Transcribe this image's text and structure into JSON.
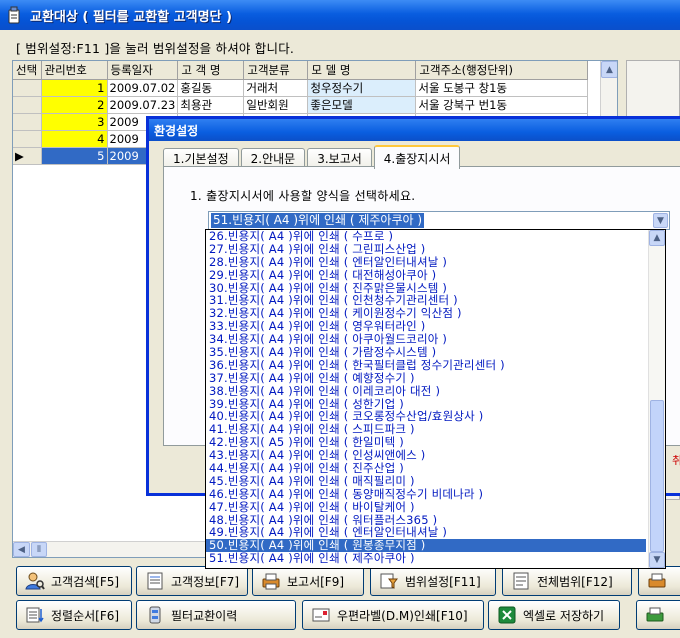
{
  "window": {
    "title": "교환대상 ( 필터를 교환할 고객명단 )"
  },
  "hint": "[ 범위설정:F11 ]을 눌러 범위설정을 하셔야 합니다.",
  "grid": {
    "headers": [
      "선택",
      "관리번호",
      "등록일자",
      "고 객 명",
      "고객분류",
      "모 델 명",
      "고객주소(행정단위)"
    ],
    "rows": [
      {
        "no": "1",
        "date": "2009.07.02",
        "name": "홍길동",
        "type": "거래처",
        "model": "청우정수기",
        "addr": "서울 도봉구 창1동"
      },
      {
        "no": "2",
        "date": "2009.07.23",
        "name": "최용관",
        "type": "일반회원",
        "model": "좋은모델",
        "addr": "서울 강북구 번1동"
      },
      {
        "no": "3",
        "date": "2009",
        "name": "",
        "type": "",
        "model": "",
        "addr": ""
      },
      {
        "no": "4",
        "date": "2009",
        "name": "",
        "type": "",
        "model": "",
        "addr": ""
      },
      {
        "no": "5",
        "date": "2009",
        "name": "",
        "type": "",
        "model": "",
        "addr": ""
      }
    ]
  },
  "dialog": {
    "title": "환경설정",
    "tabs": [
      "1.기본설정",
      "2.안내문",
      "3.보고서",
      "4.출장지시서"
    ],
    "prompt": "1. 출장지시서에 사용할 양식을 선택하세요.",
    "selected": "51.빈용지( A4 )위에 인쇄 ( 제주아쿠아 )",
    "side_text": "취"
  },
  "dropdown": {
    "items": [
      "26.빈용지( A4 )위에 인쇄 ( 수프로 )",
      "27.빈용지( A4 )위에 인쇄 ( 그린피스산업 )",
      "28.빈용지( A4 )위에 인쇄 ( 엔터알인터내셔날 )",
      "29.빈용지( A4 )위에 인쇄 ( 대전해성아쿠아 )",
      "30.빈용지( A4 )위에 인쇄 ( 진주맑은물시스템 )",
      "31.빈용지( A4 )위에 인쇄 ( 인천청수기관리센터 )",
      "32.빈용지( A4 )위에 인쇄 ( 케이원정수기 익산점 )",
      "33.빈용지( A4 )위에 인쇄 ( 영우워터라인 )",
      "34.빈용지( A4 )위에 인쇄 ( 아쿠아월드코리아 )",
      "35.빈용지( A4 )위에 인쇄 ( 가람정수시스템 )",
      "36.빈용지( A4 )위에 인쇄 ( 한국필터클럽 정수기관리센터 )",
      "37.빈용지( A4 )위에 인쇄 ( 예향정수기 )",
      "38.빈용지( A4 )위에 인쇄 ( 이레코리아 대전 )",
      "39.빈용지( A4 )위에 인쇄 ( 성한기업 )",
      "40.빈용지( A4 )위에 인쇄 ( 코오롱정수산업/효원상사 )",
      "41.빈용지( A4 )위에 인쇄 ( 스피드파크 )",
      "42.빈용지( A5 )위에 인쇄 ( 한일미텍 )",
      "43.빈용지( A4 )위에 인쇄 ( 인성씨앤에스 )",
      "44.빈용지( A4 )위에 인쇄 ( 진주산업 )",
      "45.빈용지( A4 )위에 인쇄 ( 매직필리미 )",
      "46.빈용지( A4 )위에 인쇄 ( 동양매직정수기 비데나라 )",
      "47.빈용지( A4 )위에 인쇄 ( 바이탈케어 )",
      "48.빈용지( A4 )위에 인쇄 ( 워터플러스365 )",
      "49.빈용지( A4 )위에 인쇄 ( 엔터알인터내셔날 )",
      "50.빈용지( A4 )위에 인쇄 ( 원봉종무지점 )",
      "51.빈용지( A4 )위에 인쇄 ( 제주아쿠아 )"
    ],
    "highlighted_index": 24
  },
  "buttons": {
    "row1": [
      "고객검색[F5]",
      "고객정보[F7]",
      "보고서[F9]",
      "범위설정[F11]",
      "전체범위[F12]"
    ],
    "row2": [
      "정렬순서[F6]",
      "필터교환이력",
      "우편라벨(D.M)인쇄[F10]",
      "엑셀로 저장하기"
    ]
  },
  "colors": {
    "title_bar": "#0a5ee0",
    "highlight": "#316ac5",
    "list_text": "#0018c0",
    "number_cell": "#ffff00"
  }
}
